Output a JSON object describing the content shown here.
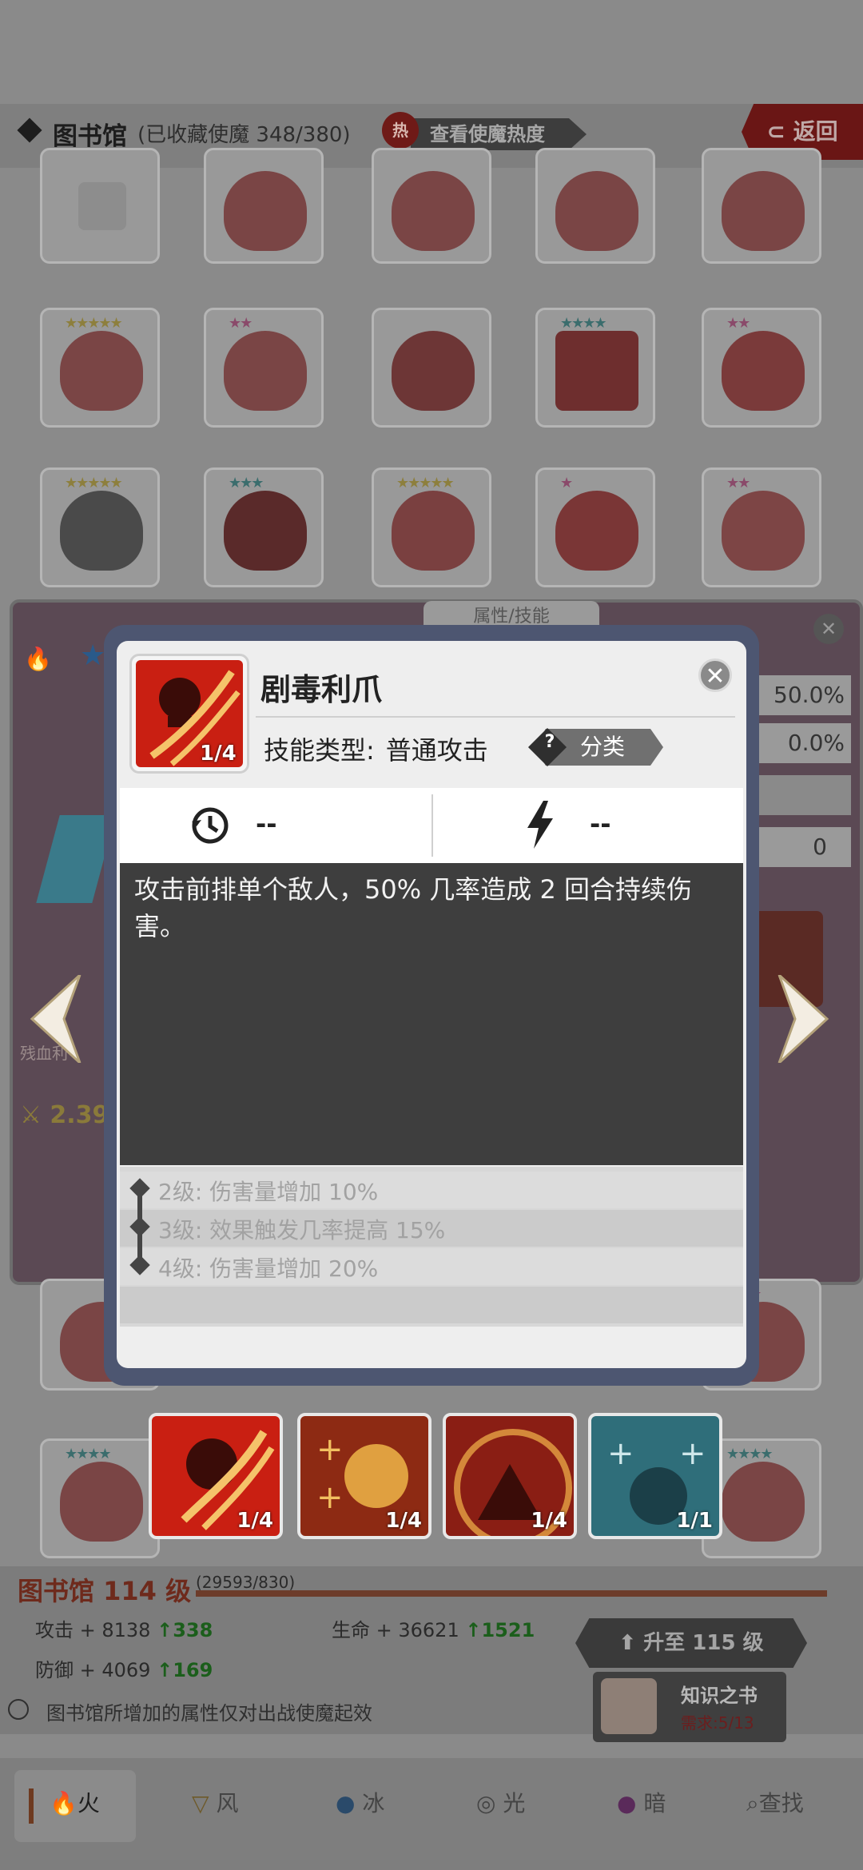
{
  "header": {
    "title": "图书馆",
    "collected": "(已收藏使魔 348/380)",
    "heat_badge": "热",
    "heat_button": "查看使魔热度",
    "back_button": "返回"
  },
  "side_panel": {
    "left_label": "残血利",
    "left_value": "2.39",
    "right_values": [
      "50.0%",
      "0.0%",
      "0"
    ],
    "tab_label": "属性/技能"
  },
  "modal": {
    "skill_name": "剧毒利爪",
    "icon_count": "1/4",
    "type_label": "技能类型:",
    "type_value": "普通攻击",
    "category_button": "分类",
    "category_icon": "?",
    "cooldown_value": "--",
    "energy_value": "--",
    "description": "攻击前排单个敌人，50% 几率造成 2 回合持续伤害。",
    "levels": [
      "2级:  伤害量增加 10%",
      "3级:  效果触发几率提高 15%",
      "4级:  伤害量增加 20%"
    ]
  },
  "skill_tiles": [
    {
      "name": "poison-claw",
      "count": "1/4",
      "color": "#c91f12"
    },
    {
      "name": "burst",
      "count": "1/4",
      "color": "#8d2a13"
    },
    {
      "name": "wolf-howl",
      "count": "1/4",
      "color": "#8a1e14"
    },
    {
      "name": "ice-beast",
      "count": "1/1",
      "color": "#2f6e7a"
    }
  ],
  "library": {
    "level": "图书馆 114 级",
    "progress": "(29593/830)",
    "attack_label": "攻击 + 8138",
    "attack_up": "338",
    "hp_label": "生命 + 36621",
    "hp_up": "1521",
    "defense_label": "防御 + 4069",
    "defense_up": "169",
    "note": "图书馆所增加的属性仅对出战使魔起效",
    "upgrade_button": "升至 115 级",
    "book_name": "知识之书",
    "book_req": "需求:5/13"
  },
  "tabs": [
    {
      "label": "火"
    },
    {
      "label": "风"
    },
    {
      "label": "冰"
    },
    {
      "label": "光"
    },
    {
      "label": "暗"
    },
    {
      "label": "查找"
    }
  ]
}
